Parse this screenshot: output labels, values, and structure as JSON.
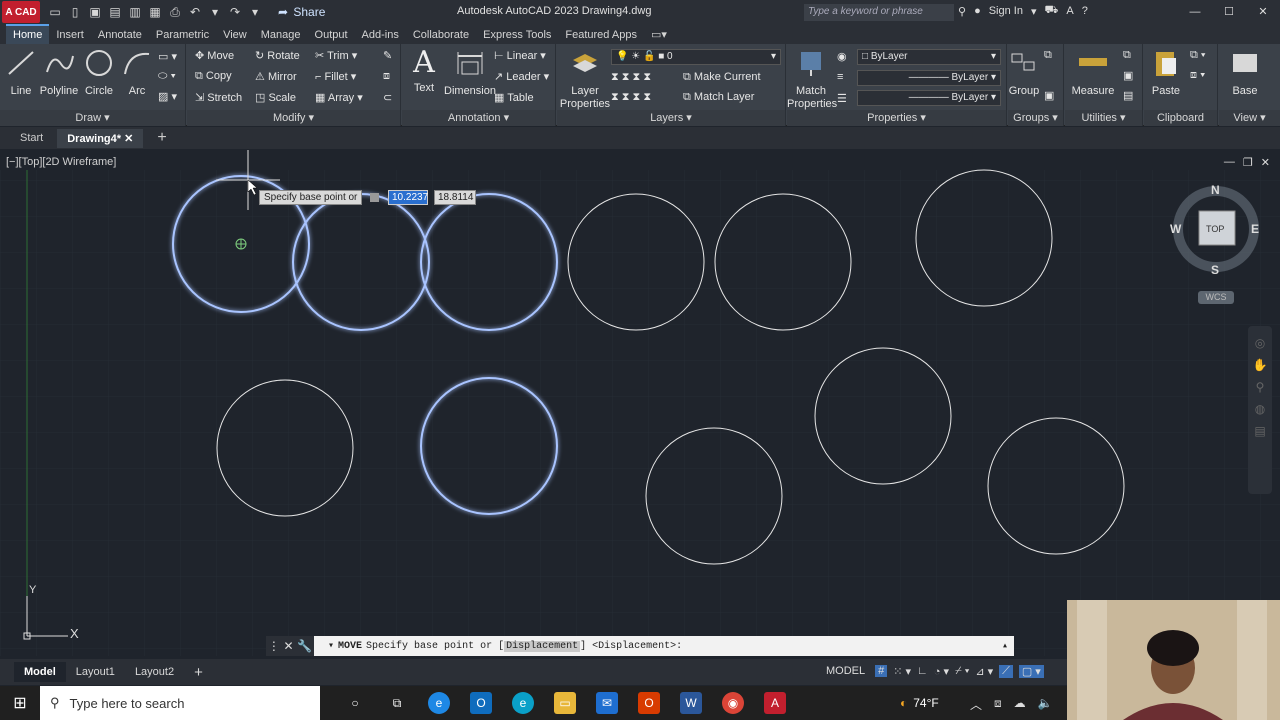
{
  "title_bar": {
    "logo_text": "A CAD",
    "share_label": "Share",
    "window_title": "Autodesk AutoCAD 2023   Drawing4.dwg",
    "search_placeholder": "Type a keyword or phrase",
    "sign_in": "Sign In"
  },
  "ribbon_tabs": [
    "Home",
    "Insert",
    "Annotate",
    "Parametric",
    "View",
    "Manage",
    "Output",
    "Add-ins",
    "Collaborate",
    "Express Tools",
    "Featured Apps"
  ],
  "ribbon": {
    "draw": {
      "title": "Draw",
      "line": "Line",
      "polyline": "Polyline",
      "circle": "Circle",
      "arc": "Arc"
    },
    "modify": {
      "title": "Modify",
      "move": "Move",
      "rotate": "Rotate",
      "trim": "Trim",
      "copy": "Copy",
      "mirror": "Mirror",
      "fillet": "Fillet",
      "stretch": "Stretch",
      "scale": "Scale",
      "array": "Array"
    },
    "annotation": {
      "title": "Annotation",
      "text": "Text",
      "dimension": "Dimension",
      "linear": "Linear",
      "leader": "Leader",
      "table": "Table"
    },
    "layers": {
      "title": "Layers",
      "layer_properties": "Layer Properties",
      "layer_value": "0",
      "make_current": "Make Current",
      "match_layer": "Match Layer"
    },
    "properties": {
      "title": "Properties",
      "match_properties": "Match Properties",
      "color": "ByLayer",
      "linetype": "ByLayer",
      "lineweight": "ByLayer"
    },
    "groups": {
      "title": "Groups",
      "group": "Group"
    },
    "utilities": {
      "title": "Utilities",
      "measure": "Measure"
    },
    "clipboard": {
      "title": "Clipboard",
      "paste": "Paste"
    },
    "view": {
      "title": "View",
      "base": "Base"
    }
  },
  "file_tabs": {
    "start": "Start",
    "active": "Drawing4*"
  },
  "viewport": {
    "label": "[−][Top][2D Wireframe]",
    "tooltip": "Specify base point or",
    "coord_x": "10.2237",
    "coord_y": "18.8114",
    "viewcube": {
      "top": "TOP",
      "n": "N",
      "s": "S",
      "e": "E",
      "w": "W",
      "wcs": "WCS"
    },
    "ucs_y": "Y",
    "ucs_x": "X"
  },
  "command_line": {
    "command": "MOVE",
    "prompt": "Specify base point or [",
    "option": "Displacement",
    "suffix": "] <Displacement>:"
  },
  "layout_tabs": [
    "Model",
    "Layout1",
    "Layout2"
  ],
  "status": {
    "model": "MODEL"
  },
  "taskbar": {
    "search_placeholder": "Type here to search",
    "temperature": "74°F"
  }
}
